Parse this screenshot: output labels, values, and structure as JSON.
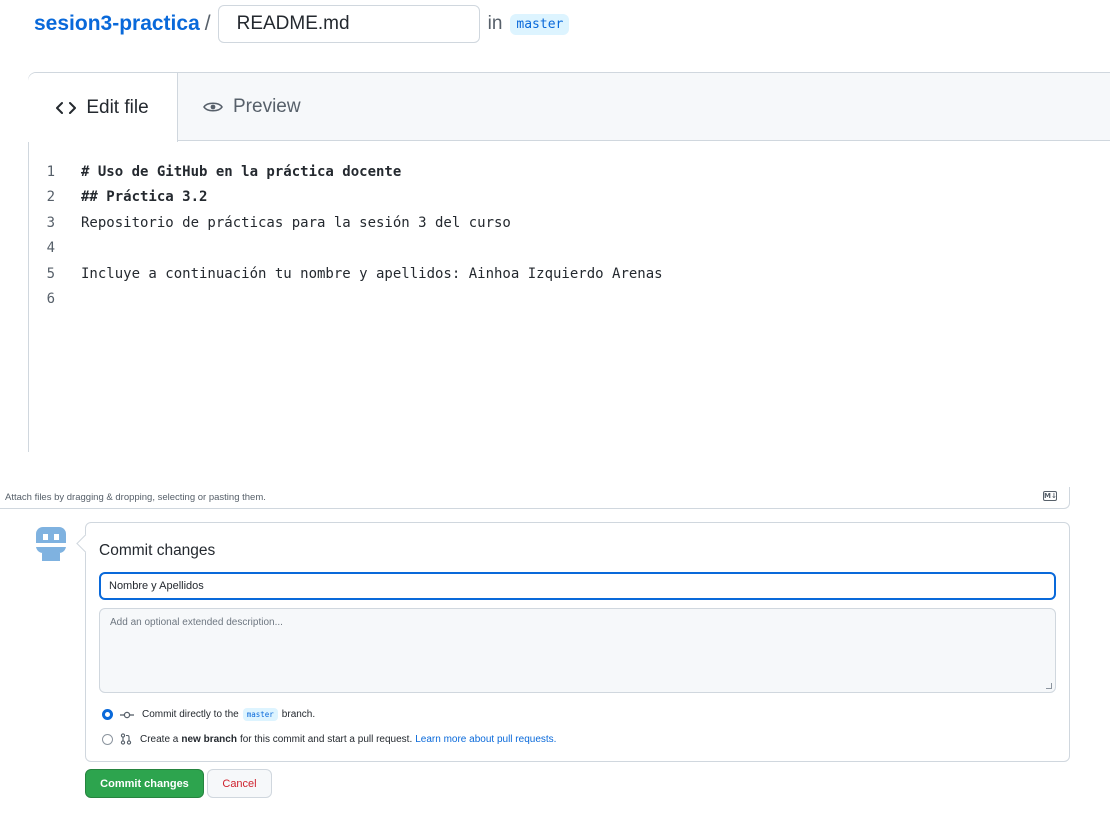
{
  "breadcrumb": {
    "repo": "sesion3-practica",
    "separator": "/",
    "filename": "README.md",
    "in_label": "in",
    "branch": "master"
  },
  "editor": {
    "tabs": [
      {
        "label": "Edit file",
        "icon": "code-icon",
        "active": true
      },
      {
        "label": "Preview",
        "icon": "eye-icon",
        "active": false
      }
    ],
    "lines": [
      {
        "n": "1",
        "text": "# Uso de GitHub en la práctica docente"
      },
      {
        "n": "2",
        "text": "## Práctica 3.2"
      },
      {
        "n": "3",
        "text": "Repositorio de prácticas para la sesión 3 del curso"
      },
      {
        "n": "4",
        "text": ""
      },
      {
        "n": "5",
        "text": "Incluye a continuación tu nombre y apellidos: Ainhoa Izquierdo Arenas"
      },
      {
        "n": "6",
        "text": ""
      }
    ]
  },
  "attach": {
    "text": "Attach files by dragging & dropping, selecting or pasting them.",
    "md_badge": "M↓"
  },
  "commit": {
    "title": "Commit changes",
    "summary_value": "Nombre y Apellidos",
    "description_placeholder": "Add an optional extended description...",
    "option_direct": {
      "prefix": "Commit directly to the",
      "branch": "master",
      "suffix": "branch."
    },
    "option_new_branch": {
      "prefix": "Create a",
      "bold": "new branch",
      "suffix": "for this commit and start a pull request.",
      "link": "Learn more about pull requests."
    },
    "commit_button": "Commit changes",
    "cancel_button": "Cancel"
  },
  "colors": {
    "accent": "#0969da",
    "commit_green": "#2da44e",
    "cancel_red": "#cf222e",
    "avatar": "#7fb2e0"
  }
}
